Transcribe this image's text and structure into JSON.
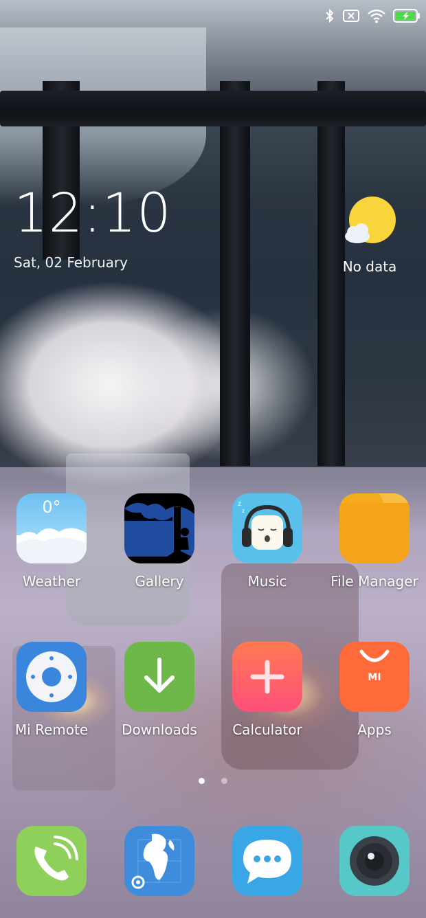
{
  "status_bar": {
    "icons": [
      "bluetooth-icon",
      "no-sim-icon",
      "wifi-icon",
      "battery-charging-icon"
    ]
  },
  "clock": {
    "time": "12:10",
    "date": "Sat, 02 February"
  },
  "weather_widget": {
    "icon": "sun-cloud-icon",
    "label": "No data"
  },
  "apps": [
    {
      "label": "Weather",
      "icon": "weather-icon",
      "temp": "0°"
    },
    {
      "label": "Gallery",
      "icon": "gallery-icon"
    },
    {
      "label": "Music",
      "icon": "music-icon"
    },
    {
      "label": "File Manager",
      "icon": "folder-icon"
    },
    {
      "label": "Mi Remote",
      "icon": "remote-icon"
    },
    {
      "label": "Downloads",
      "icon": "download-icon"
    },
    {
      "label": "Calculator",
      "icon": "calculator-icon"
    },
    {
      "label": "Apps",
      "icon": "mi-store-icon",
      "badge": "MI"
    }
  ],
  "page_indicator": {
    "count": 2,
    "active": 1
  },
  "dock": [
    {
      "icon": "phone-icon"
    },
    {
      "icon": "browser-icon"
    },
    {
      "icon": "messages-icon"
    },
    {
      "icon": "camera-icon"
    }
  ],
  "colors": {
    "weather": "#7cc7f2",
    "gallery": "#1f4c9e",
    "music": "#58c0ea",
    "file_manager": "#f5ac1c",
    "mi_remote": "#3a86dc",
    "downloads": "#6eb84a",
    "calculator": "#ff5c7a",
    "apps": "#ff6a3a",
    "phone": "#8fd05a",
    "browser": "#3e8cdc",
    "messages": "#39a6e6",
    "camera": "#55c8c7"
  }
}
